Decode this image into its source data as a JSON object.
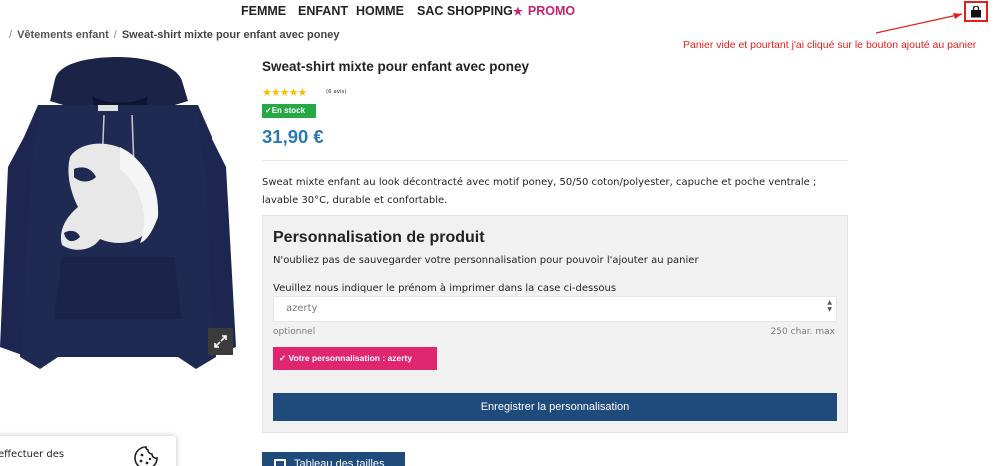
{
  "nav": {
    "items": [
      {
        "label": "FEMME"
      },
      {
        "label": "ENFANT"
      },
      {
        "label": "HOMME"
      },
      {
        "label": "SAC SHOPPING"
      },
      {
        "label": "PROMO",
        "icon": "star-icon"
      }
    ]
  },
  "annotation": {
    "text": "Panier vide et pourtant j'ai cliqué sur le bouton ajouté au panier",
    "color": "#e0201b"
  },
  "breadcrumb": {
    "separator": "/",
    "items": [
      "Vêtements enfant",
      "Sweat-shirt mixte pour enfant avec poney"
    ]
  },
  "product": {
    "title": "Sweat-shirt mixte pour enfant avec poney",
    "rating": 5,
    "stars": "★★★★★",
    "reviews": "(6 avis)",
    "stock": "En stock",
    "price": "31,90 €",
    "description": "Sweat mixte enfant au look décontracté avec motif poney, 50/50 coton/polyester, capuche et poche ventrale ; lavable 30°C, durable et confortable."
  },
  "personalisation": {
    "title": "Personnalisation de produit",
    "note": "N'oubliez pas de sauvegarder votre personnalisation pour pouvoir l'ajouter au panier",
    "field_label": "Veuillez nous indiquer le prénom à imprimer dans la case ci-dessous",
    "field_value": "azerty",
    "optional": "optionnel",
    "max_chars": "250 char. max",
    "badge": "Votre personnalisation : azerty",
    "save_button": "Enregistrer la personnalisation"
  },
  "size_button": "Tableau des tailles",
  "cookie": {
    "text": "effectuer des"
  },
  "colors": {
    "accent_blue": "#1f4a7c",
    "price_blue": "#2b7ab8",
    "stock_green": "#26a845",
    "promo_pink": "#c5216e",
    "badge_pink": "#e0266f"
  }
}
